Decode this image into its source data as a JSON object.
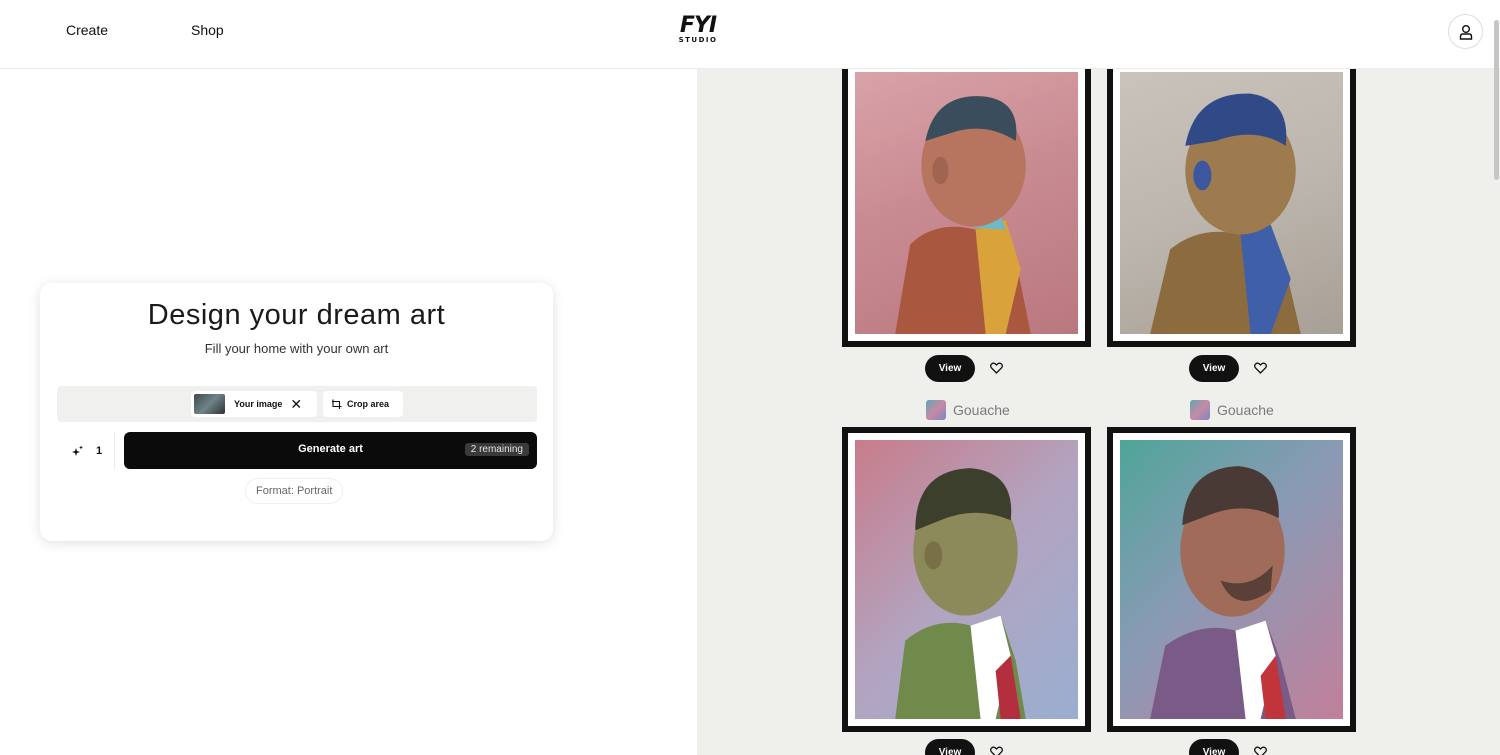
{
  "nav": {
    "create": "Create",
    "shop": "Shop"
  },
  "brand": {
    "logo_main": "FYI",
    "logo_sub": "STUDIO"
  },
  "account": {
    "icon": "user-icon"
  },
  "card": {
    "title": "Design your dream art",
    "subtitle": "Fill your home with your own art",
    "upload": {
      "image_label": "Your image",
      "crop_label": "Crop area"
    },
    "quantity": "1",
    "generate_label": "Generate art",
    "remaining": "2 remaining",
    "format": "Format: Portrait"
  },
  "gallery": {
    "items": [
      {
        "view": "View"
      },
      {
        "view": "View"
      },
      {
        "view": "View",
        "style": "Gouache"
      },
      {
        "view": "View",
        "style": "Gouache"
      }
    ]
  },
  "colors": {
    "primary": "#0b0b0b",
    "gallery_bg": "#eff0ec"
  }
}
